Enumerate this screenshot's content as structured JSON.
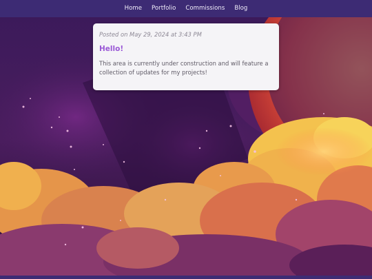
{
  "nav": {
    "items": [
      {
        "label": "Home"
      },
      {
        "label": "Portfolio"
      },
      {
        "label": "Commissions"
      },
      {
        "label": "Blog"
      }
    ]
  },
  "post": {
    "date": "Posted on May 29, 2024 at 3:43 PM",
    "title": "Hello!",
    "body": "This area is currently under construction and will feature a collection of updates for my projects!"
  },
  "colors": {
    "nav_background": "#3d2b74",
    "nav_text": "#f1eefa",
    "card_background": "#f5f4f7",
    "title_accent": "#9a58d6",
    "date_text": "#8c8794",
    "body_text": "#5f5a66"
  },
  "background": {
    "description_icon": "galaxy-clouds-illustration"
  }
}
